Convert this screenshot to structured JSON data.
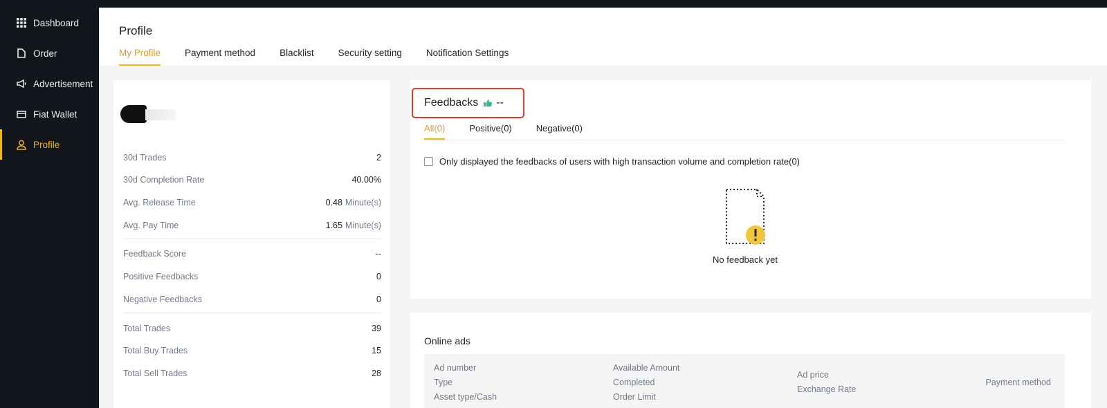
{
  "sidebar": {
    "items": [
      {
        "label": "Dashboard",
        "icon": "grid-icon"
      },
      {
        "label": "Order",
        "icon": "document-icon"
      },
      {
        "label": "Advertisement",
        "icon": "megaphone-icon"
      },
      {
        "label": "Fiat Wallet",
        "icon": "wallet-icon"
      },
      {
        "label": "Profile",
        "icon": "user-icon",
        "active": true
      }
    ]
  },
  "header": {
    "title": "Profile",
    "tabs": [
      "My Profile",
      "Payment method",
      "Blacklist",
      "Security setting",
      "Notification Settings"
    ],
    "active_tab": "My Profile"
  },
  "stats": {
    "trades_30d": {
      "label": "30d Trades",
      "value": "2"
    },
    "completion_30d": {
      "label": "30d Completion Rate",
      "value": "40.00%"
    },
    "release_time": {
      "label": "Avg. Release Time",
      "value": "0.48",
      "unit": "Minute(s)"
    },
    "pay_time": {
      "label": "Avg. Pay Time",
      "value": "1.65",
      "unit": "Minute(s)"
    },
    "feedback_score": {
      "label": "Feedback Score",
      "value": "--"
    },
    "positive": {
      "label": "Positive Feedbacks",
      "value": "0"
    },
    "negative": {
      "label": "Negative Feedbacks",
      "value": "0"
    },
    "total": {
      "label": "Total Trades",
      "value": "39"
    },
    "buy": {
      "label": "Total Buy Trades",
      "value": "15"
    },
    "sell": {
      "label": "Total Sell Trades",
      "value": "28"
    }
  },
  "feedbacks": {
    "title": "Feedbacks",
    "score": "--",
    "tabs": [
      "All(0)",
      "Positive(0)",
      "Negative(0)"
    ],
    "filter_label": "Only displayed the feedbacks of users with high transaction volume and completion rate(0)",
    "empty_text": "No feedback yet"
  },
  "online_ads": {
    "title": "Online ads",
    "columns": {
      "ad_number": "Ad number",
      "type": "Type",
      "asset_type": "Asset type/Cash",
      "available_amount": "Available Amount",
      "completed": "Completed",
      "order_limit": "Order Limit",
      "ad_price": "Ad price",
      "exchange_rate": "Exchange Rate",
      "payment_method": "Payment method"
    }
  },
  "colors": {
    "accent": "#f0b90b",
    "highlight_border": "#e03b2a",
    "sidebar_bg": "#12161c",
    "positive": "#2ebd85"
  }
}
